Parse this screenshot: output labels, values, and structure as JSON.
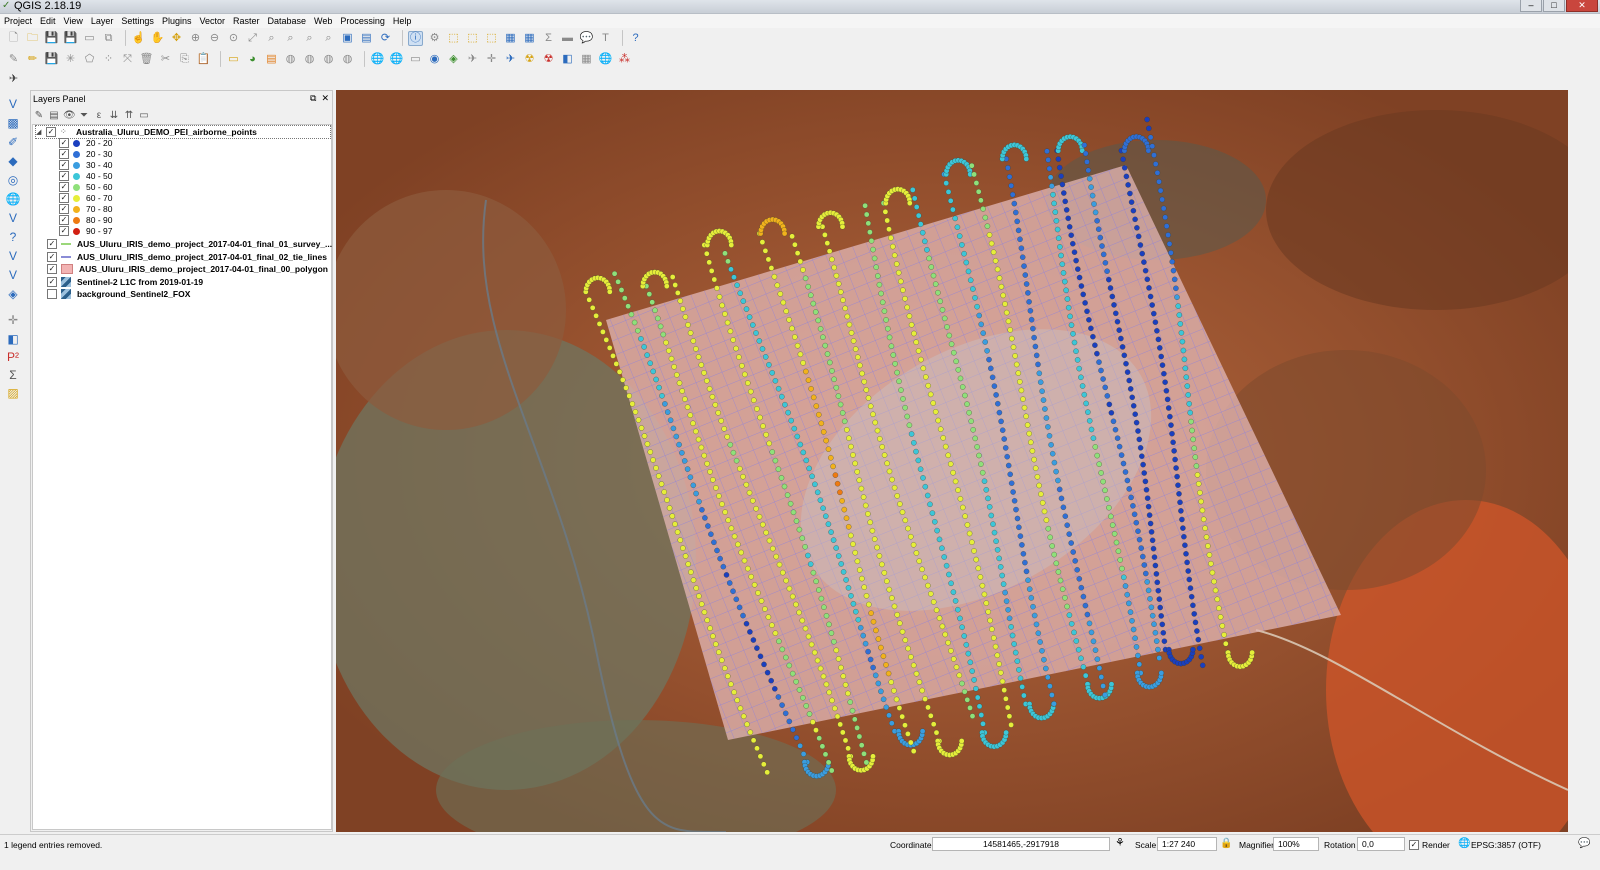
{
  "window": {
    "title": "QGIS 2.18.19",
    "min": "‒",
    "max": "□",
    "close": "✕"
  },
  "menu": [
    "Project",
    "Edit",
    "View",
    "Layer",
    "Settings",
    "Plugins",
    "Vector",
    "Raster",
    "Database",
    "Web",
    "Processing",
    "Help"
  ],
  "layers_panel": {
    "title": "Layers Panel",
    "float_btn": "⧉",
    "close_btn": "✕",
    "group": "Australia_Uluru_DEMO_PEI_airborne_points",
    "legend": [
      {
        "label": "20 - 20",
        "color": "#1a3fbf"
      },
      {
        "label": "20 - 30",
        "color": "#2f6fd6"
      },
      {
        "label": "30 - 40",
        "color": "#3a9de0"
      },
      {
        "label": "40 - 50",
        "color": "#3cc6d8"
      },
      {
        "label": "50 - 60",
        "color": "#8fe07a"
      },
      {
        "label": "60 - 70",
        "color": "#e6ee3a"
      },
      {
        "label": "70 - 80",
        "color": "#f2b21c"
      },
      {
        "label": "80 - 90",
        "color": "#ee7a12"
      },
      {
        "label": "90 - 97",
        "color": "#d21f12"
      }
    ],
    "layers": [
      {
        "name": "AUS_Uluru_IRIS_demo_project_2017-04-01_final_01_survey_...",
        "type": "line",
        "color": "#9bd77a",
        "checked": true
      },
      {
        "name": "AUS_Uluru_IRIS_demo_project_2017-04-01_final_02_tie_lines",
        "type": "line",
        "color": "#8a8cd6",
        "checked": true
      },
      {
        "name": "AUS_Uluru_IRIS_demo_project_2017-04-01_final_00_polygon",
        "type": "polygon",
        "color": "#f2b3b3",
        "checked": true
      },
      {
        "name": "Sentinel-2 L1C from 2019-01-19",
        "type": "raster",
        "checked": true
      },
      {
        "name": "background_Sentinel2_FOX",
        "type": "raster",
        "checked": false
      }
    ]
  },
  "status": {
    "message": "1 legend entries removed.",
    "coordinate_label": "Coordinate",
    "coordinate_value": "14581465,-2917918",
    "scale_label": "Scale",
    "scale_value": "1:27 240",
    "magnifier_label": "Magnifier",
    "magnifier_value": "100%",
    "rotation_label": "Rotation",
    "rotation_value": "0,0",
    "render_label": "Render",
    "crs": "EPSG:3857 (OTF)"
  }
}
